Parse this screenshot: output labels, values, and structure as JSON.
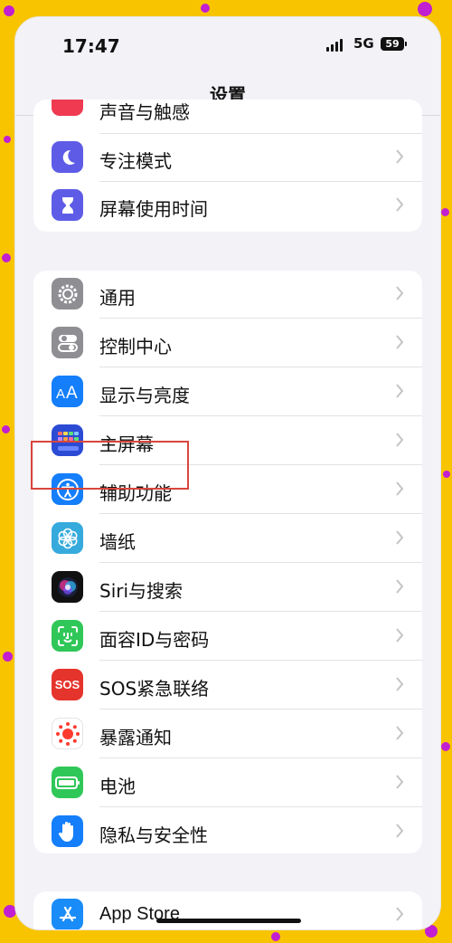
{
  "status_bar": {
    "time": "17:47",
    "network": "5G",
    "battery": "59"
  },
  "nav": {
    "title": "设置"
  },
  "top_group": {
    "partial_label": "声音与触感",
    "items": [
      {
        "label": "专注模式",
        "icon": "moon-icon",
        "color": "#5e5ce6"
      },
      {
        "label": "屏幕使用时间",
        "icon": "hourglass-icon",
        "color": "#5e5ce6"
      }
    ]
  },
  "main_group": {
    "items": [
      {
        "label": "通用",
        "icon": "gear-icon",
        "color": "#8e8e93"
      },
      {
        "label": "控制中心",
        "icon": "toggles-icon",
        "color": "#8e8e93"
      },
      {
        "label": "显示与亮度",
        "icon": "text-size-icon",
        "color": "#147efb"
      },
      {
        "label": "主屏幕",
        "icon": "app-grid-icon",
        "color": "#2c4bd4"
      },
      {
        "label": "辅助功能",
        "icon": "accessibility-icon",
        "color": "#147efb",
        "highlighted": true
      },
      {
        "label": "墙纸",
        "icon": "flower-icon",
        "color": "#36aadc"
      },
      {
        "label": "Siri与搜索",
        "icon": "siri-icon",
        "color": "#111111"
      },
      {
        "label": "面容ID与密码",
        "icon": "face-id-icon",
        "color": "#30c759"
      },
      {
        "label": "SOS紧急联络",
        "icon": "sos-icon",
        "color": "#e5342c",
        "icon_text": "SOS"
      },
      {
        "label": "暴露通知",
        "icon": "exposure-icon",
        "color": "#ffffff"
      },
      {
        "label": "电池",
        "icon": "battery-icon",
        "color": "#30c759"
      },
      {
        "label": "隐私与安全性",
        "icon": "hand-icon",
        "color": "#147efb"
      }
    ]
  },
  "bottom_group": {
    "items": [
      {
        "label": "App Store",
        "icon": "app-store-icon",
        "color": "#1a8cf8"
      }
    ]
  }
}
